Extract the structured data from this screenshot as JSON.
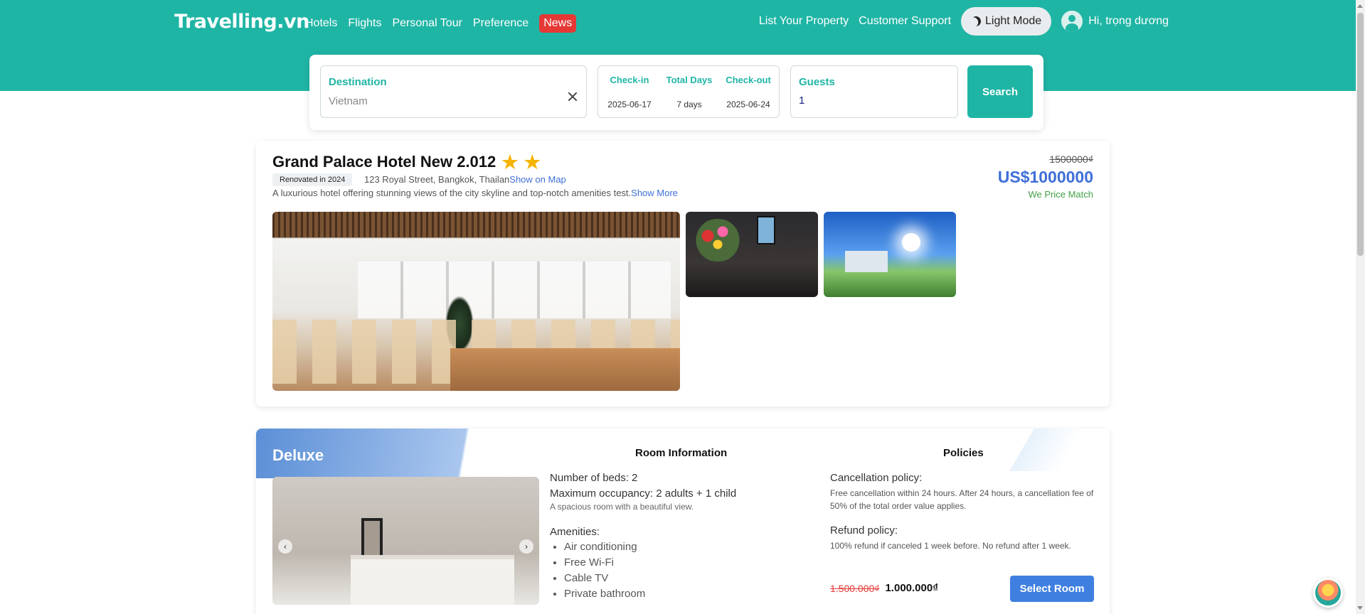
{
  "header": {
    "brand": "Travelling.vn",
    "nav": [
      "Hotels",
      "Flights",
      "Personal Tour",
      "Preference",
      "News"
    ],
    "list_property": "List Your Property",
    "support": "Customer Support",
    "mode": "Light Mode",
    "greeting": "Hi, trọng dương"
  },
  "search": {
    "destination_label": "Destination",
    "destination_value": "Vietnam",
    "checkin_label": "Check-in",
    "total_label": "Total Days",
    "checkout_label": "Check-out",
    "checkin": "2025-06-17",
    "total": "7 days",
    "checkout": "2025-06-24",
    "guests_label": "Guests",
    "guests": "1",
    "button": "Search"
  },
  "hotel": {
    "name": "Grand Palace Hotel New 2.012",
    "stars": 2,
    "renovated": "Renovated in 2024",
    "address": "123 Royal Street, Bangkok, Thailan",
    "show_map": "Show on Map",
    "description": "A luxurious hotel offering stunning views of the city skyline and top-notch amenities test.",
    "show_more": "Show More",
    "old_price": "1500000₫",
    "price": "US$1000000",
    "price_match": "We Price Match"
  },
  "room": {
    "name": "Deluxe",
    "info_title": "Room Information",
    "beds": "Number of beds: 2",
    "occupancy": "Maximum occupancy: 2 adults + 1 child",
    "room_desc": "A spacious room with a beautiful view.",
    "amenities_title": "Amenities:",
    "amenities": [
      "Air conditioning",
      "Free Wi-Fi",
      "Cable TV",
      "Private bathroom"
    ],
    "policies_title": "Policies",
    "cancel_title": "Cancellation policy:",
    "cancel_text": "Free cancellation within 24 hours. After 24 hours, a cancellation fee of 50% of the total order value applies.",
    "refund_title": "Refund policy:",
    "refund_text": "100% refund if canceled 1 week before. No refund after 1 week.",
    "old_price": "1.500.000₫",
    "price": "1.000.000₫",
    "select": "Select Room"
  },
  "colors": {
    "brand": "#1fb5a5",
    "accent": "#3f7fe0",
    "news": "#e53935"
  }
}
